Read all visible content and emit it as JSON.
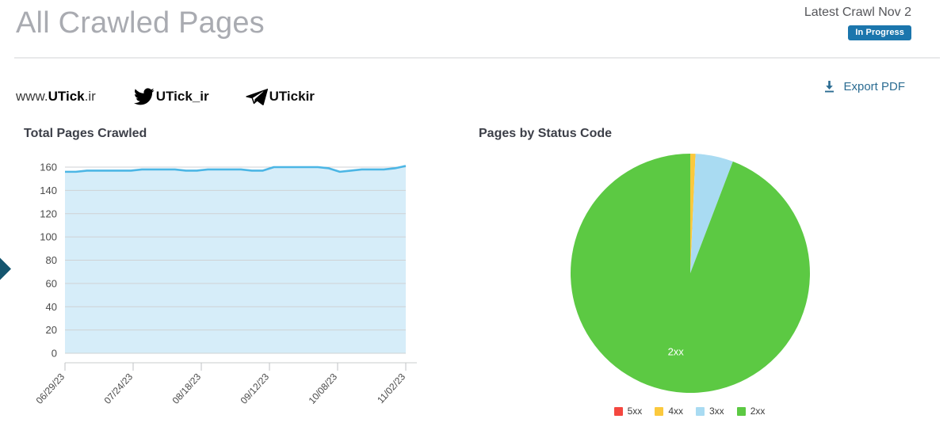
{
  "header": {
    "title": "All Crawled Pages",
    "crawl_date": "Latest Crawl Nov 2",
    "status": "In Progress",
    "status_color": "#1b76ad"
  },
  "brand": {
    "site_prefix": "www.",
    "site_name": "UTick",
    "site_tld": ".ir",
    "socials": [
      {
        "icon": "twitter-icon",
        "handle": "UTick_ir"
      },
      {
        "icon": "telegram-icon",
        "handle": "UTickir"
      }
    ]
  },
  "actions": {
    "export_label": "Export PDF",
    "export_icon": "download-icon",
    "export_color": "#2b6c92"
  },
  "edge": {
    "icon": "right-triangle-icon",
    "color": "#14556f"
  },
  "sections": {
    "line_title": "Total Pages Crawled",
    "pie_title": "Pages by Status Code"
  },
  "chart_data": [
    {
      "type": "line",
      "title": "Total Pages Crawled",
      "xlabel": "",
      "ylabel": "",
      "ylim": [
        0,
        160
      ],
      "yticks": [
        0,
        20,
        40,
        60,
        80,
        100,
        120,
        140,
        160
      ],
      "grid": true,
      "legend": "none",
      "line_color": "#4cb6e5",
      "fill_color": "#d6edf9",
      "xticks": [
        "06/29/23",
        "07/24/23",
        "08/18/23",
        "09/12/23",
        "10/08/23",
        "11/02/23"
      ],
      "x": [
        "06/29/23",
        "07/02/23",
        "07/05/23",
        "07/09/23",
        "07/13/23",
        "07/17/23",
        "07/21/23",
        "07/24/23",
        "07/28/23",
        "08/01/23",
        "08/05/23",
        "08/09/23",
        "08/13/23",
        "08/18/23",
        "08/22/23",
        "08/26/23",
        "08/30/23",
        "09/03/23",
        "09/07/23",
        "09/12/23",
        "09/16/23",
        "09/20/23",
        "09/24/23",
        "09/28/23",
        "10/02/23",
        "10/08/23",
        "10/12/23",
        "10/16/23",
        "10/20/23",
        "10/24/23",
        "10/28/23",
        "11/02/23"
      ],
      "values": [
        156,
        156,
        157,
        157,
        157,
        157,
        157,
        158,
        158,
        158,
        158,
        157,
        157,
        158,
        158,
        158,
        158,
        157,
        157,
        160,
        160,
        160,
        160,
        160,
        159,
        156,
        157,
        158,
        158,
        158,
        159,
        161
      ]
    },
    {
      "type": "pie",
      "title": "Pages by Status Code",
      "legend_position": "bottom",
      "categories": [
        "5xx",
        "4xx",
        "3xx",
        "2xx"
      ],
      "values": [
        0,
        0.7,
        5.1,
        94.2
      ],
      "colors": [
        "#f4473f",
        "#f9c council",
        "#a9dbf2",
        "#5cc943"
      ],
      "slice_labels": [
        "",
        "",
        "",
        "2xx"
      ],
      "visible_label": "2xx"
    }
  ],
  "pie_legend": [
    {
      "label": "5xx",
      "color": "#f4473f"
    },
    {
      "label": "4xx",
      "color": "#fbc93d"
    },
    {
      "label": "3xx",
      "color": "#a9dbf2"
    },
    {
      "label": "2xx",
      "color": "#5cc943"
    }
  ]
}
